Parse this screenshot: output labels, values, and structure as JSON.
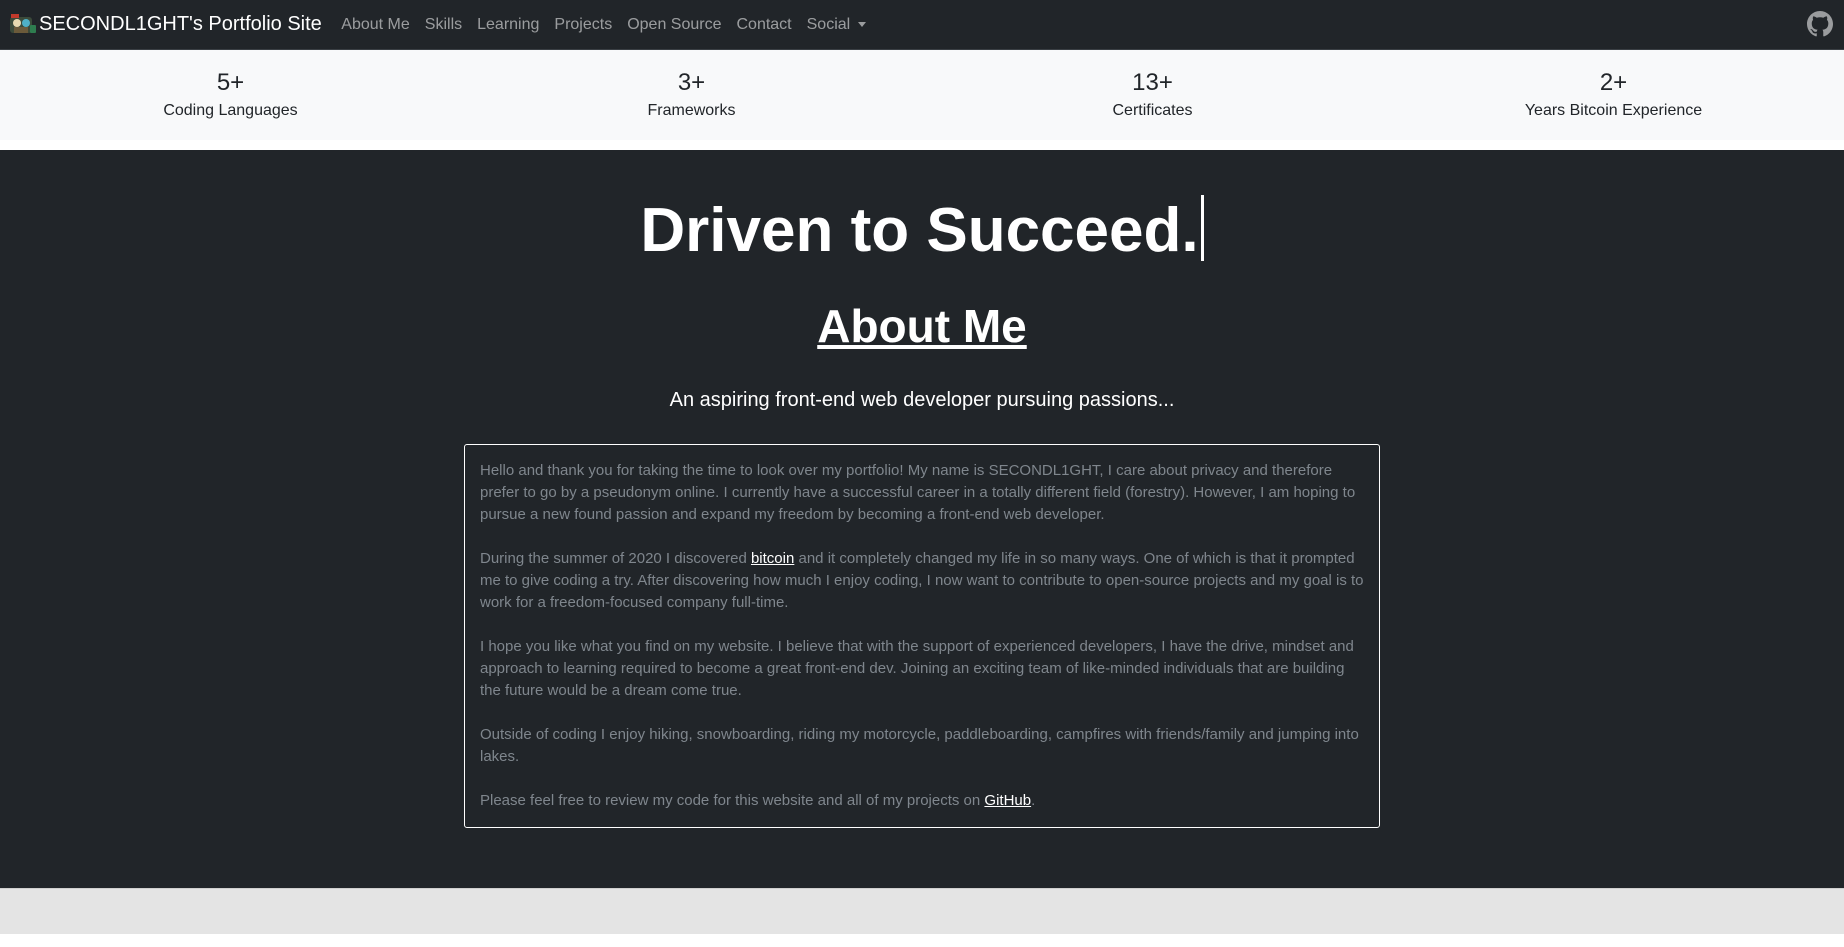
{
  "navbar": {
    "brand_title": "SECONDL1GHT's Portfolio Site",
    "links": [
      "About Me",
      "Skills",
      "Learning",
      "Projects",
      "Open Source",
      "Contact"
    ],
    "dropdown_label": "Social",
    "logo_icon": "avatar-logo-icon",
    "github_icon": "github-icon"
  },
  "stats": [
    {
      "value": "5+",
      "label": "Coding Languages"
    },
    {
      "value": "3+",
      "label": "Frameworks"
    },
    {
      "value": "13+",
      "label": "Certificates"
    },
    {
      "value": "2+",
      "label": "Years Bitcoin Experience"
    }
  ],
  "hero": {
    "tagline": "Driven to Succeed.",
    "about_title": "About Me",
    "about_subtitle": "An aspiring front-end web developer pursuing passions..."
  },
  "about": {
    "p1": "Hello and thank you for taking the time to look over my portfolio! My name is SECONDL1GHT, I care about privacy and therefore prefer to go by a pseudonym online. I currently have a successful career in a totally different field (forestry). However, I am hoping to pursue a new found passion and expand my freedom by becoming a front-end web developer.",
    "p2_before": "During the summer of 2020 I discovered ",
    "p2_link": "bitcoin",
    "p2_after": " and it completely changed my life in so many ways. One of which is that it prompted me to give coding a try. After discovering how much I enjoy coding, I now want to contribute to open-source projects and my goal is to work for a freedom-focused company full-time.",
    "p3": "I hope you like what you find on my website. I believe that with the support of experienced developers, I have the drive, mindset and approach to learning required to become a great front-end dev. Joining an exciting team of like-minded individuals that are building the future would be a dream come true.",
    "p4": "Outside of coding I enjoy hiking, snowboarding, riding my motorcycle, paddleboarding, campfires with friends/family and jumping into lakes.",
    "p5_before": "Please feel free to review my code for this website and all of my projects on ",
    "p5_link": "GitHub",
    "p5_after": "."
  },
  "colors": {
    "dark_bg": "#212529",
    "stats_bg": "#f8f9fa",
    "muted_text": "#7f868d",
    "nav_link": "rgba(255,255,255,0.55)"
  }
}
